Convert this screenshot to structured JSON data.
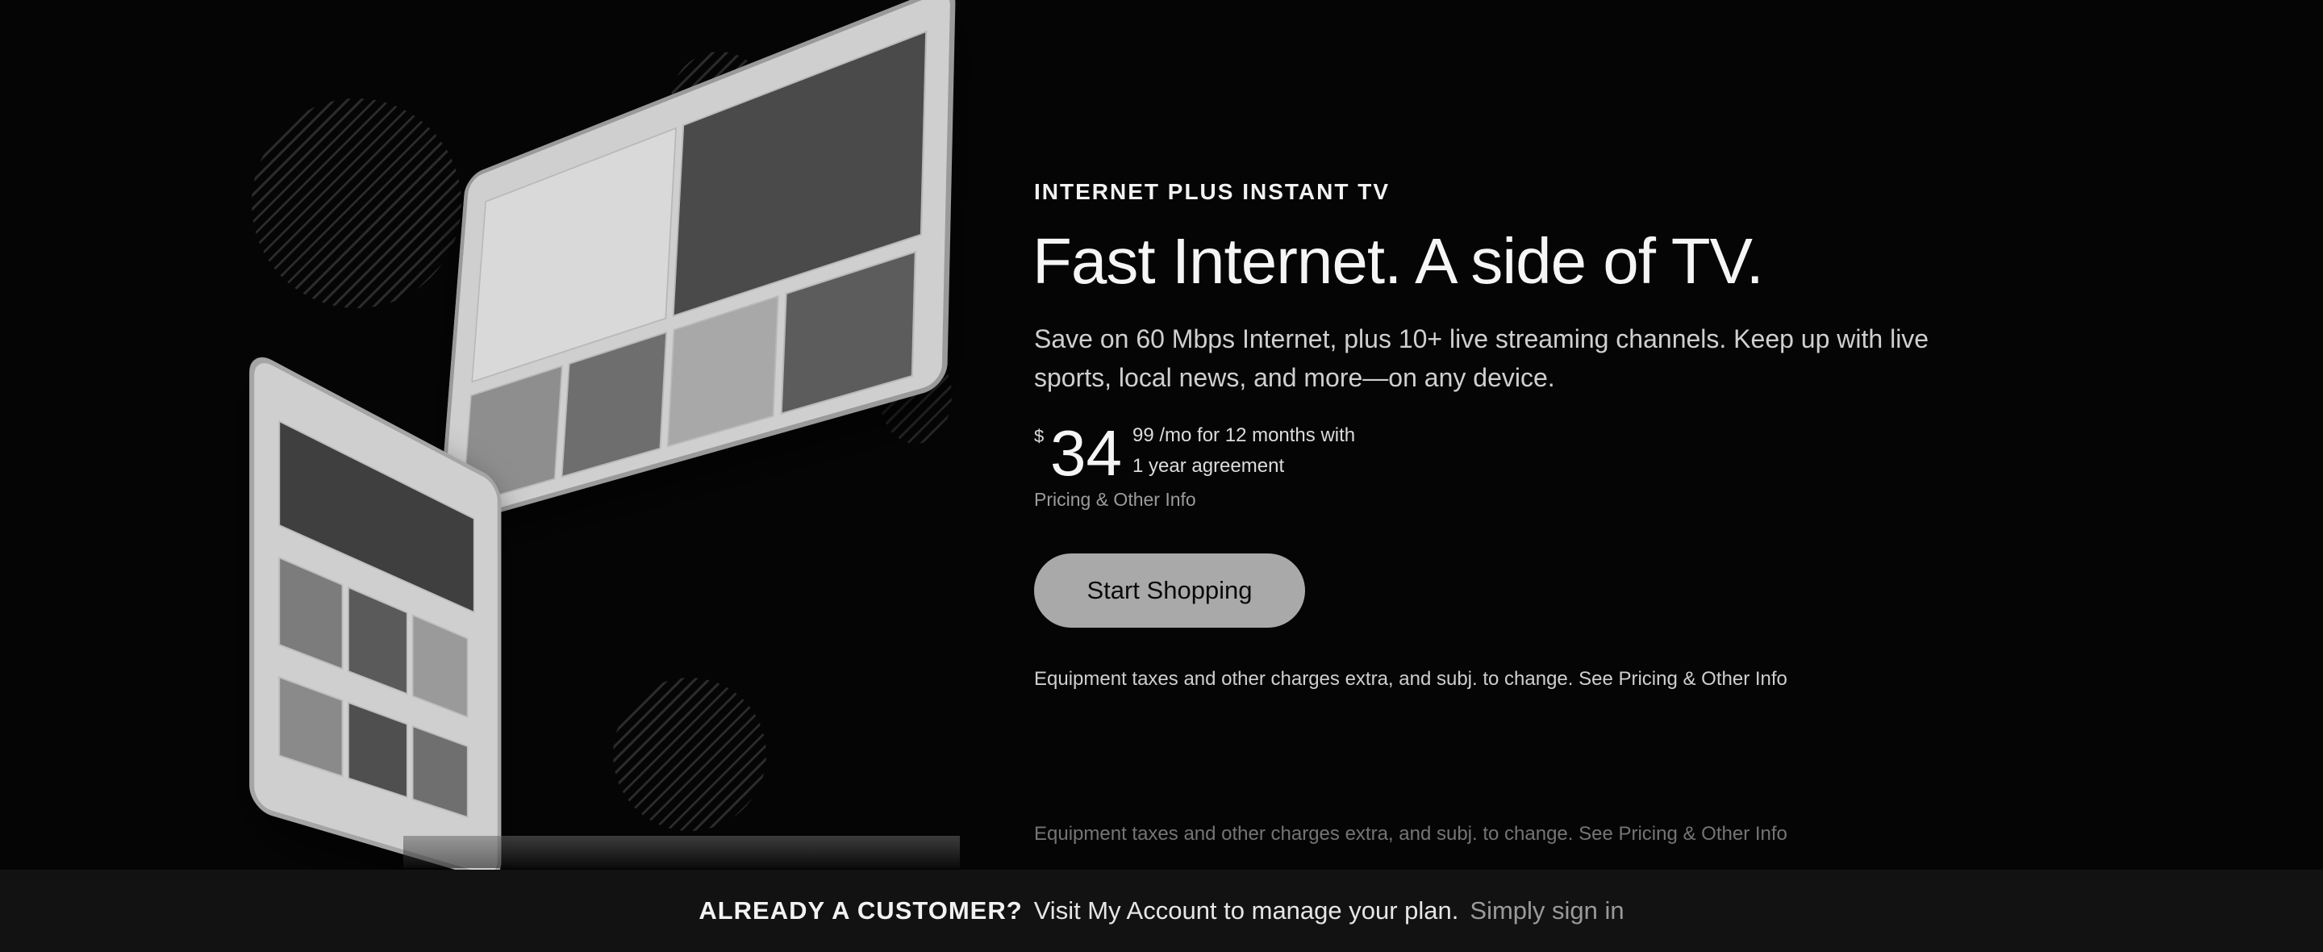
{
  "hero": {
    "eyebrow": "INTERNET PLUS INSTANT TV",
    "headline": "Fast Internet. A side of TV.",
    "description": "Save on 60 Mbps Internet, plus 10+ live streaming channels. Keep up with live sports, local news, and more—on any device.",
    "price": {
      "currency": "$",
      "dollars": "34",
      "cents_and_term": "99 /mo for 12 months with",
      "agreement": "1 year agreement"
    },
    "pricing_link": "Pricing & Other Info",
    "cta_label": "Start Shopping",
    "disclaimer": "Equipment taxes and other charges extra, and subj. to change. See Pricing & Other Info"
  },
  "bottom_bar": {
    "question": "ALREADY A CUSTOMER?",
    "message": "Visit My Account to manage your plan.",
    "signin_link": "Simply sign in"
  },
  "colors": {
    "background": "#050505",
    "cta_background": "#a9a9a9",
    "bar_background": "#121212",
    "muted_link": "#9a9a9a"
  }
}
